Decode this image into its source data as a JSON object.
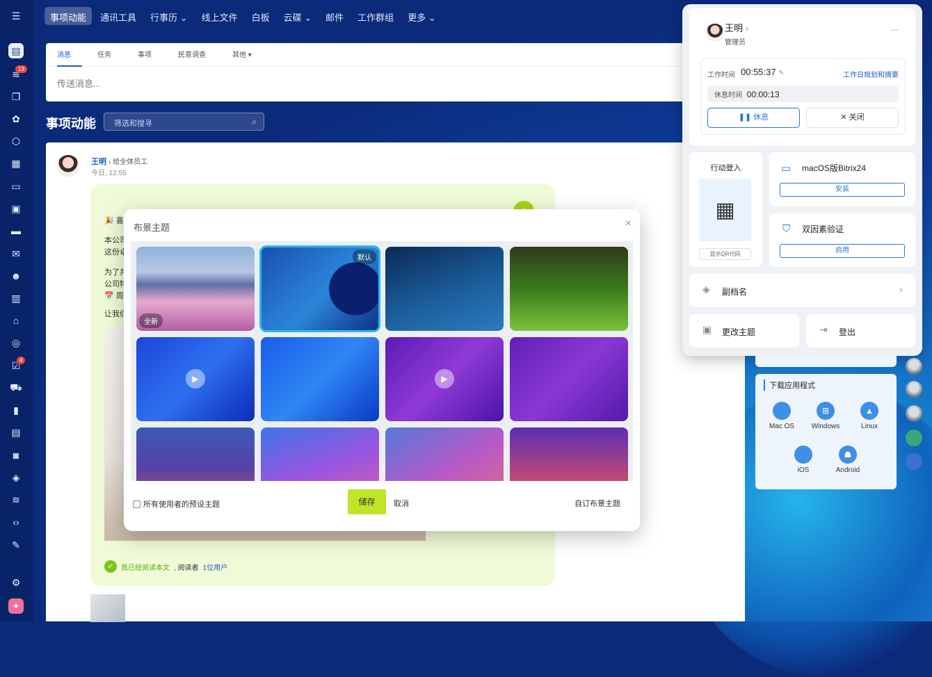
{
  "topnav": {
    "items": [
      "事项动能",
      "通讯工具",
      "行事历",
      "线上文件",
      "白板",
      "云碟",
      "邮件",
      "工作群组",
      "更多"
    ],
    "dropdowns": [
      false,
      false,
      true,
      false,
      false,
      true,
      false,
      false,
      true
    ]
  },
  "rail": {
    "icons": [
      "menu-icon",
      "feed-icon",
      "notification-icon",
      "chat-icon",
      "collab-icon",
      "hexagon-icon",
      "calendar-icon",
      "document-icon",
      "board-icon",
      "drive-icon",
      "mail-icon",
      "group-icon",
      "schedule-icon",
      "store-icon",
      "target-icon",
      "task-icon",
      "cart-icon",
      "analytics-icon",
      "crm-icon",
      "bot-icon",
      "box-icon",
      "sites-icon",
      "code-icon",
      "edit-icon",
      "settings-icon",
      "app-icon"
    ],
    "badges": {
      "notifications": "13",
      "tasks": "4"
    }
  },
  "composer": {
    "tabs": [
      "消息",
      "任务",
      "事项",
      "民意调查",
      "其他"
    ],
    "placeholder": "传送消息..."
  },
  "feed": {
    "title": "事项动能",
    "search_placeholder": "筛选和搜寻"
  },
  "post": {
    "author": "王明",
    "recipient": "给全体员工",
    "time": "今日, 12:55",
    "line1": "🎉 喜",
    "line2": "本公司",
    "line3": "这份卓",
    "line4": "为了共",
    "line5": "公司特",
    "line6": "📅 周工",
    "line7": "让我们",
    "read_text": "我已经阅读本文",
    "readers_label": ", 阅读者",
    "readers_count": "1位用户"
  },
  "dialog": {
    "title": "布景主题",
    "new_badge": "全新",
    "default_badge": "默认",
    "checkbox_label": "所有使用者的预设主题",
    "save": "储存",
    "cancel": "取消",
    "custom": "自订布景主题"
  },
  "profile": {
    "name": "王明",
    "role": "管理员",
    "work_time_label": "工作时间",
    "work_time": "00:55:37",
    "plan_link": "工作日规划和摘要",
    "rest_label": "休息时间",
    "rest_time": "00:00:13",
    "pause": "休息",
    "close": "关闭",
    "mobile_login": "行动登入",
    "show_qr": "显示QR代码",
    "macos_app": "macOS版Bitrix24",
    "install": "安装",
    "twofa": "双因素验证",
    "enable": "启用",
    "alias": "副档名",
    "change_theme": "更改主题",
    "logout": "登出"
  },
  "downloads": {
    "title": "下载应用程式",
    "apps": [
      "Mac OS",
      "Windows",
      "Linux",
      "iOS",
      "Android"
    ]
  },
  "colors": {
    "accent": "#1f5dc7",
    "save_green": "#bfe529",
    "post_bg": "#eefbd6"
  }
}
